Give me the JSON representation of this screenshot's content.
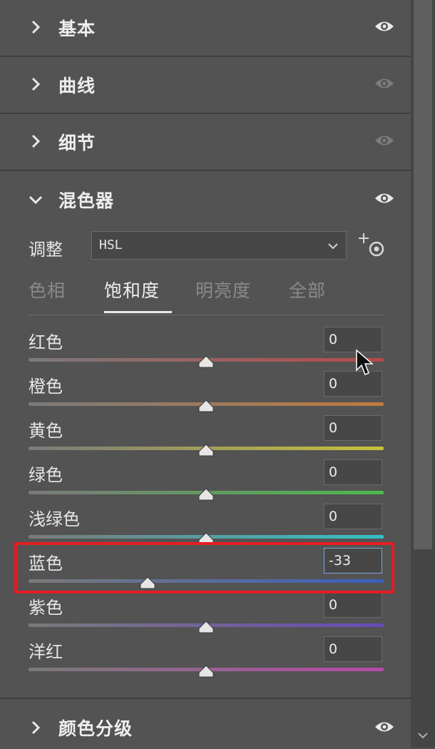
{
  "sections": [
    {
      "label": "基本",
      "expanded": false,
      "visible": true
    },
    {
      "label": "曲线",
      "expanded": false,
      "visible": false
    },
    {
      "label": "细节",
      "expanded": false,
      "visible": false
    }
  ],
  "mixer": {
    "title": "混色器",
    "expanded": true,
    "adjust_label": "调整",
    "adjust_value": "HSL",
    "tabs": [
      {
        "label": "色相",
        "active": false
      },
      {
        "label": "饱和度",
        "active": true
      },
      {
        "label": "明亮度",
        "active": false
      },
      {
        "label": "全部",
        "active": false
      }
    ],
    "sliders": [
      {
        "label": "红色",
        "value": "0",
        "level": 0,
        "track_color": "#b84a4a"
      },
      {
        "label": "橙色",
        "value": "0",
        "level": 0,
        "track_color": "#c07a3e"
      },
      {
        "label": "黄色",
        "value": "0",
        "level": 0,
        "track_color": "#c8c23a"
      },
      {
        "label": "绿色",
        "value": "0",
        "level": 0,
        "track_color": "#4cba4c"
      },
      {
        "label": "浅绿色",
        "value": "0",
        "level": 0,
        "track_color": "#35c0c6"
      },
      {
        "label": "蓝色",
        "value": "-33",
        "level": -33,
        "track_color": "#3a5fbc",
        "focused": true
      },
      {
        "label": "紫色",
        "value": "0",
        "level": 0,
        "track_color": "#6a4ab6"
      },
      {
        "label": "洋红",
        "value": "0",
        "level": 0,
        "track_color": "#b64aa8"
      }
    ]
  },
  "bottom_section": {
    "label": "颜色分级",
    "expanded": false,
    "visible": true
  },
  "colors": {
    "highlight": "#e51c24",
    "eye_visible": "#e8e8e8",
    "eye_hidden": "#8a8a8a"
  }
}
